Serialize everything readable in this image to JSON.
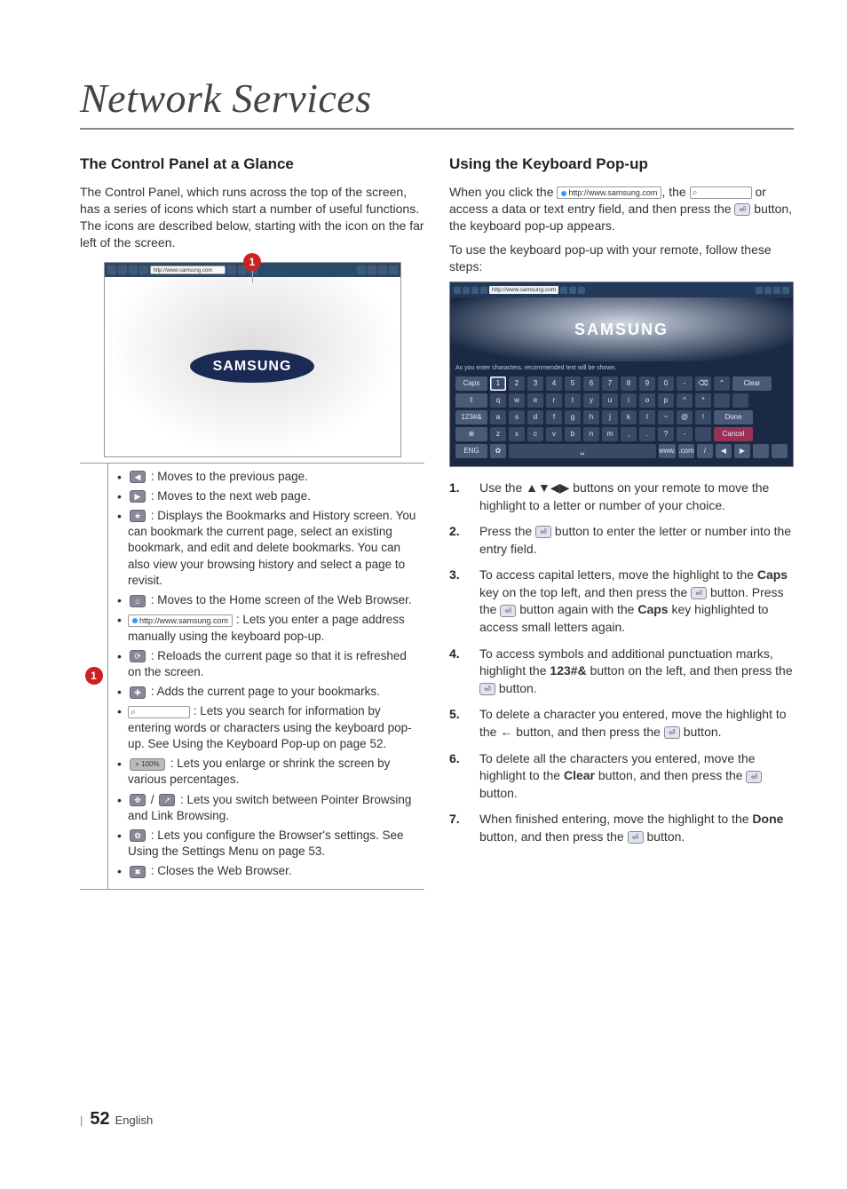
{
  "chapter_title": "Network Services",
  "left": {
    "section_title": "The Control Panel at a Glance",
    "intro": "The Control Panel, which runs across the top of the screen, has a series of icons which start a number of useful functions. The icons are described below, starting with the icon on the far left of the screen.",
    "callout_number": "1",
    "mock_url": "http://www.samsung.com",
    "samsung_logo": "SAMSUNG",
    "legend_number": "1",
    "items": {
      "back": ": Moves to the previous page.",
      "forward": ": Moves to the next web page.",
      "bookmarks": ": Displays the Bookmarks and History screen. You can bookmark the current page, select an existing bookmark, and edit and delete bookmarks. You can also view your browsing history and select a page to revisit.",
      "home": ": Moves to the Home screen of the Web Browser.",
      "addr_value": "http://www.samsung.com",
      "addr": ": Lets you enter a page address manually using the keyboard pop-up.",
      "reload": ": Reloads the current page so that it is refreshed on the screen.",
      "add_bm": ": Adds the current page to your bookmarks.",
      "search": ": Lets you search for information by entering words or characters using the keyboard pop-up. See Using the Keyboard Pop-up on page 52.",
      "zoom_label": "100%",
      "zoom": ": Lets you enlarge or shrink the screen by various percentages.",
      "pointer": ": Lets you switch between Pointer Browsing and Link Browsing.",
      "settings": ": Lets you configure the Browser's settings. See Using the Settings Menu on page 53.",
      "close": ": Closes the Web Browser."
    }
  },
  "right": {
    "section_title": "Using the Keyboard Pop-up",
    "intro_a": "When you click the ",
    "intro_url": "http://www.samsung.com",
    "intro_b": ", the ",
    "intro_c": " or access a data or text entry field, and then press the ",
    "intro_d": " button, the keyboard pop-up appears.",
    "intro2": "To use the keyboard pop-up with your remote, follow these steps:",
    "kb_url": "http://www.samsung.com",
    "kb_logo": "SAMSUNG",
    "kb_hint": "As you enter characters, recommended text will be shown.",
    "kb_actions": {
      "clear": "Clear",
      "done": "Done",
      "cancel": "Cancel"
    },
    "kb_rows": {
      "r1_left": "Caps",
      "r1_keys": [
        "1",
        "2",
        "3",
        "4",
        "5",
        "6",
        "7",
        "8",
        "9",
        "0",
        "-",
        "⌫",
        "⌃"
      ],
      "r2_left": "⇧",
      "r2_keys": [
        "q",
        "w",
        "e",
        "r",
        "t",
        "y",
        "u",
        "i",
        "o",
        "p",
        "^",
        "*"
      ],
      "r3_left": "123#&",
      "r3_keys": [
        "a",
        "s",
        "d",
        "f",
        "g",
        "h",
        "j",
        "k",
        "l",
        "~",
        "@",
        "!"
      ],
      "r4_left": "⊕",
      "r4_keys": [
        "z",
        "x",
        "c",
        "v",
        "b",
        "n",
        "m",
        ",",
        ".",
        "?",
        "-"
      ],
      "r5_left": "ENG",
      "r5_keys_a": "✿",
      "r5_keys_space": "␣",
      "r5_keys_b": [
        "www.",
        ".com",
        "/",
        "◀",
        "▶"
      ]
    },
    "steps": {
      "s1": "Use the ▲▼◀▶ buttons on your remote to move the highlight to a letter or number of your choice.",
      "s2a": "Press the ",
      "s2b": " button to enter the letter or number into the entry field.",
      "s3a": "To access capital letters, move the highlight to the ",
      "s3_caps": "Caps",
      "s3b": " key on the top left, and then press the ",
      "s3c": " button. Press the ",
      "s3d": " button again with the ",
      "s3e": " key highlighted to access small letters again.",
      "s4a": "To access symbols and additional punctuation marks, highlight the ",
      "s4_sym": "123#&",
      "s4b": " button on the left, and then press the ",
      "s4c": " button.",
      "s5a": "To delete a character you entered, move the highlight to the ",
      "s5_arrow": "←",
      "s5b": " button, and then press the ",
      "s5c": " button.",
      "s6a": "To delete all the characters you entered, move the highlight to the ",
      "s6_clear": "Clear",
      "s6b": " button, and then press the ",
      "s6c": " button.",
      "s7a": "When finished entering, move the highlight to the ",
      "s7_done": "Done",
      "s7b": " button, and then press the ",
      "s7c": " button."
    }
  },
  "footer": {
    "page": "52",
    "lang": "English"
  }
}
